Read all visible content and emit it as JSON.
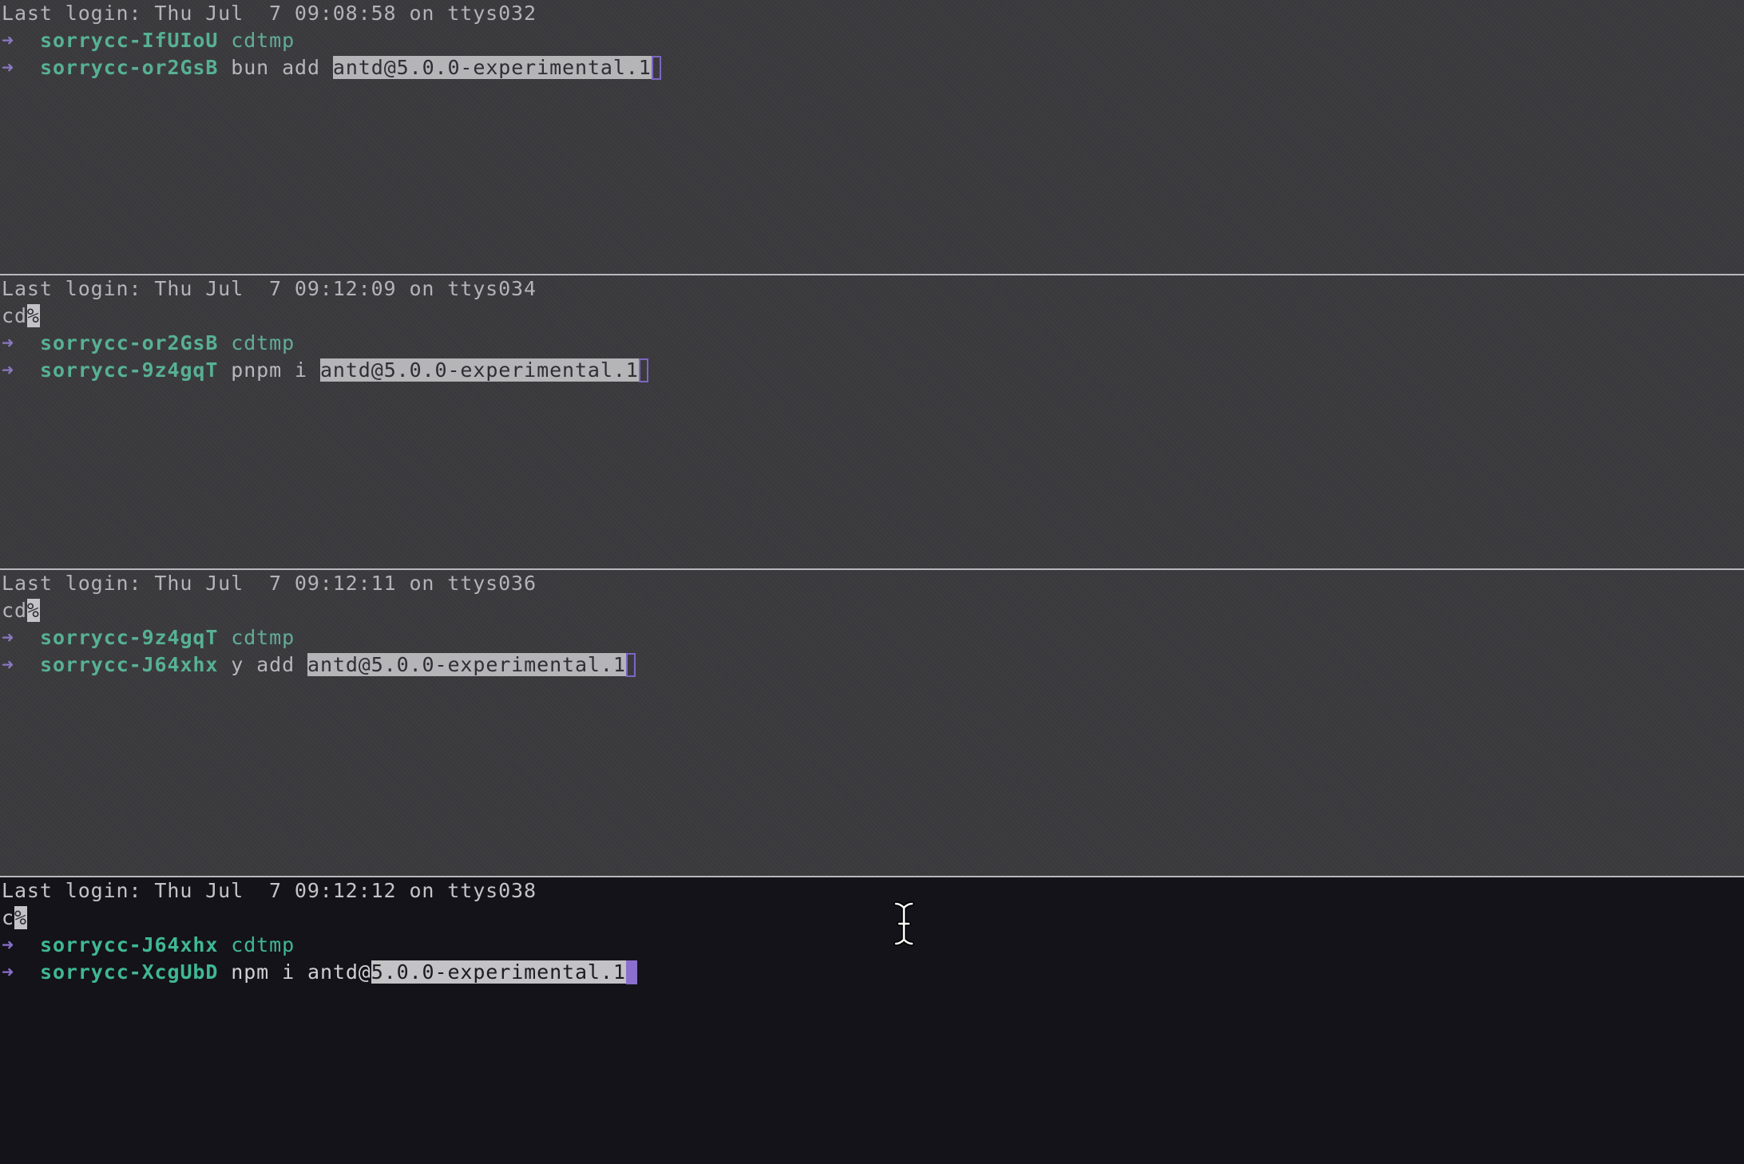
{
  "arrow_glyph": "➜",
  "colors": {
    "prompt_arrow": "#8a6fcf",
    "hostname": "#3fb893",
    "inactive_bg": "#3a3a3d",
    "active_bg": "#141319",
    "selection_bg": "#c3c3c6"
  },
  "panes": [
    {
      "last_login": "Last login: Thu Jul  7 09:08:58 on ttys032",
      "prompt1": {
        "host": "sorrycc-IfUIoU",
        "dir": "cdtmp"
      },
      "prompt2": {
        "host": "sorrycc-or2GsB",
        "cmd_prefix": "bun add ",
        "selected": "antd@5.0.0-experimental.1"
      }
    },
    {
      "last_login": "Last login: Thu Jul  7 09:12:09 on ttys034",
      "pre_text": "cd",
      "pre_mark": "%",
      "prompt1": {
        "host": "sorrycc-or2GsB",
        "dir": "cdtmp"
      },
      "prompt2": {
        "host": "sorrycc-9z4gqT",
        "cmd_prefix": "pnpm i ",
        "selected": "antd@5.0.0-experimental.1"
      }
    },
    {
      "last_login": "Last login: Thu Jul  7 09:12:11 on ttys036",
      "pre_text": "cd",
      "pre_mark": "%",
      "prompt1": {
        "host": "sorrycc-9z4gqT",
        "dir": "cdtmp"
      },
      "prompt2": {
        "host": "sorrycc-J64xhx",
        "cmd_prefix": "y add ",
        "selected": "antd@5.0.0-experimental.1"
      }
    },
    {
      "last_login": "Last login: Thu Jul  7 09:12:12 on ttys038",
      "pre_text": "c",
      "pre_mark": "%",
      "prompt1": {
        "host": "sorrycc-J64xhx",
        "dir": "cdtmp"
      },
      "prompt2": {
        "host": "sorrycc-XcgUbD",
        "cmd_prefix": "npm i antd@",
        "selected": "5.0.0-experimental.1"
      }
    }
  ],
  "mouse_cursor": "text-ibeam-icon"
}
